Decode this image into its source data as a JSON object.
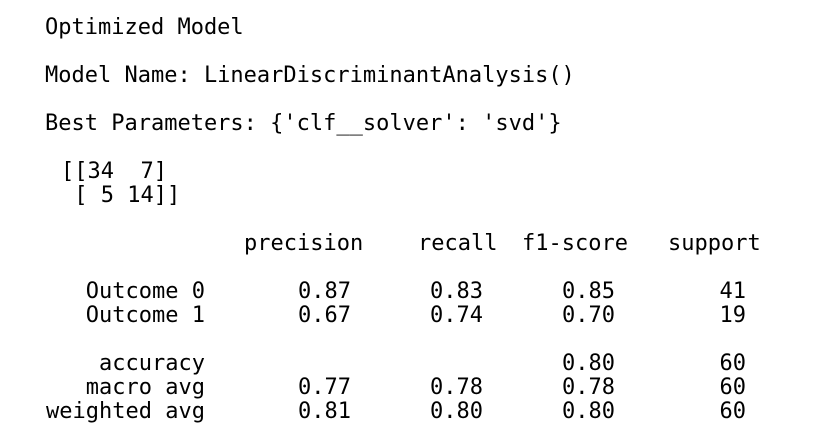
{
  "output": {
    "title": "Optimized Model",
    "model_name_line": "Model Name: LinearDiscriminantAnalysis()",
    "best_params_line": "Best Parameters: {'clf__solver': 'svd'}",
    "confusion_matrix": [
      "[[34  7]",
      " [ 5 14]]"
    ],
    "report": {
      "headers": [
        "precision",
        "recall",
        "f1-score",
        "support"
      ],
      "rows": [
        {
          "label": "Outcome 0",
          "precision": "0.87",
          "recall": "0.83",
          "f1": "0.85",
          "support": "41"
        },
        {
          "label": "Outcome 1",
          "precision": "0.67",
          "recall": "0.74",
          "f1": "0.70",
          "support": "19"
        }
      ],
      "summary": [
        {
          "label": "accuracy",
          "precision": "",
          "recall": "",
          "f1": "0.80",
          "support": "60"
        },
        {
          "label": "macro avg",
          "precision": "0.77",
          "recall": "0.78",
          "f1": "0.78",
          "support": "60"
        },
        {
          "label": "weighted avg",
          "precision": "0.81",
          "recall": "0.80",
          "f1": "0.80",
          "support": "60"
        }
      ]
    }
  }
}
